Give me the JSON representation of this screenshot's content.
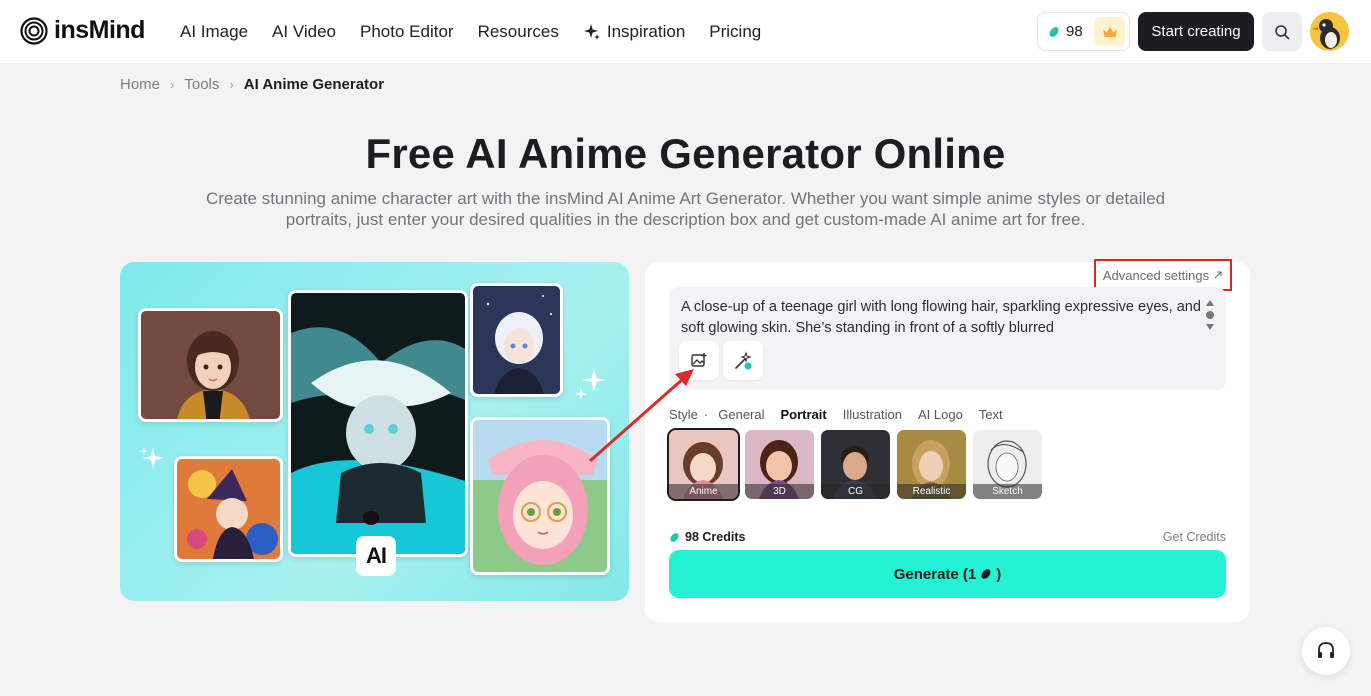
{
  "header": {
    "logo_text": "insMind",
    "nav": [
      {
        "label": "AI Image"
      },
      {
        "label": "AI Video"
      },
      {
        "label": "Photo Editor"
      },
      {
        "label": "Resources"
      },
      {
        "label": "Inspiration",
        "icon": "sparkle-icon"
      },
      {
        "label": "Pricing"
      }
    ],
    "credits": "98",
    "start_button": "Start creating"
  },
  "breadcrumb": {
    "home": "Home",
    "tools": "Tools",
    "current": "AI Anime Generator"
  },
  "hero": {
    "title": "Free AI Anime Generator Online",
    "subtitle": "Create stunning anime character art with the insMind AI Anime Art Generator. Whether you want simple anime styles or detailed portraits, just enter your desired qualities in the description box and get custom-made AI anime art for free."
  },
  "showcase": {
    "ai_badge": "AI"
  },
  "panel": {
    "advanced_settings": "Advanced settings",
    "prompt": "A close-up of a teenage girl with long flowing hair, sparkling expressive eyes, and soft glowing skin. She’s standing in front of a softly blurred",
    "style_label": "Style",
    "style_dot": "·",
    "style_tabs": [
      "General",
      "Portrait",
      "Illustration",
      "AI Logo",
      "Text"
    ],
    "active_tab": "Portrait",
    "styles": [
      {
        "label": "Anime",
        "selected": true
      },
      {
        "label": "3D"
      },
      {
        "label": "CG"
      },
      {
        "label": "Realistic"
      },
      {
        "label": "Sketch"
      }
    ],
    "credits_text": "98 Credits",
    "get_credits": "Get Credits",
    "generate_label": "Generate (1",
    "generate_suffix": ")"
  },
  "colors": {
    "accent": "#23f2d3",
    "highlight": "#d92626",
    "dark": "#1c1d22"
  }
}
